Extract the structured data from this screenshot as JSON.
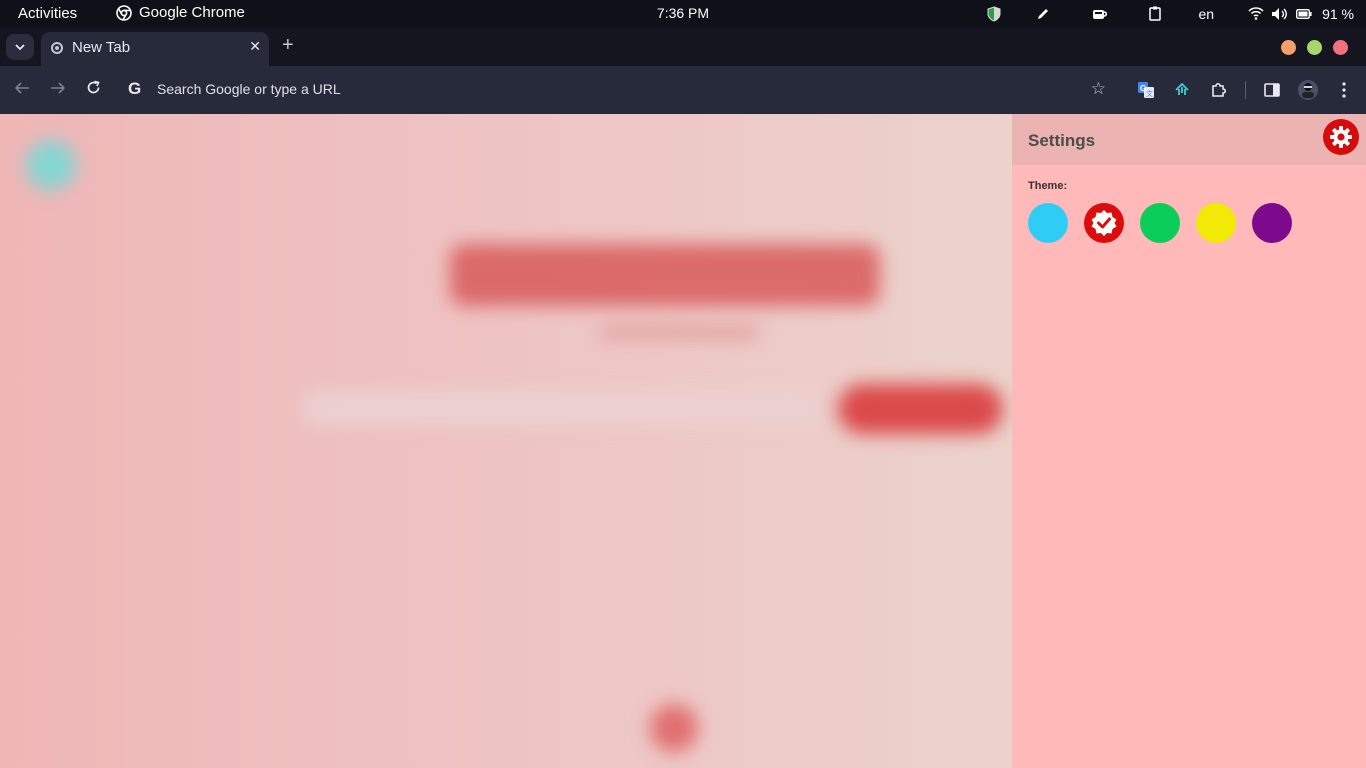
{
  "topbar": {
    "activities": "Activities",
    "app_name": "Google Chrome",
    "clock": "7:36 PM",
    "language": "en",
    "battery": "91 %",
    "icons": [
      "shield-icon",
      "pen-icon",
      "coffee-icon",
      "clipboard-icon",
      "wifi-icon",
      "volume-icon",
      "battery-icon"
    ]
  },
  "browser": {
    "tab_title": "New Tab",
    "omnibox_placeholder": "Search Google or type a URL",
    "window_controls": {
      "minimize": "#f5a06a",
      "maximize": "#a5d76e",
      "close": "#f2707e"
    }
  },
  "settings": {
    "title": "Settings",
    "theme_label": "Theme:",
    "themes": [
      {
        "name": "cyan",
        "color": "#2fcdf5",
        "selected": false
      },
      {
        "name": "red",
        "color": "#dc0c0c",
        "selected": true
      },
      {
        "name": "green",
        "color": "#0acd5a",
        "selected": false
      },
      {
        "name": "yellow",
        "color": "#f0ea06",
        "selected": false
      },
      {
        "name": "purple",
        "color": "#7d0a8c",
        "selected": false
      }
    ]
  },
  "colors": {
    "accent": "#d60b0b",
    "panel_background": "#ffb9b9",
    "panel_header": "#ecb3b3"
  }
}
